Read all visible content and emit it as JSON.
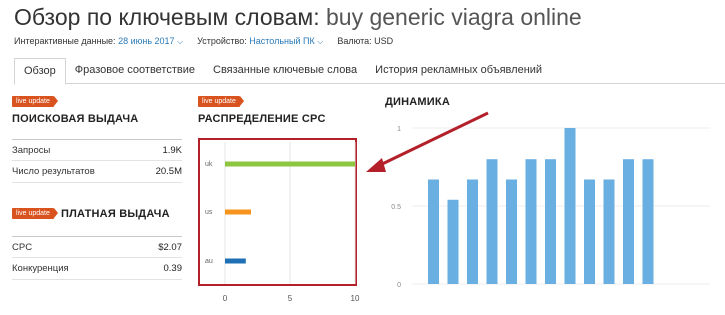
{
  "header": {
    "title_prefix": "Обзор по ключевым словам:",
    "keyword": "buy generic viagra online"
  },
  "meta": {
    "data_label": "Интерактивные данные:",
    "data_value": "28 июнь 2017",
    "device_label": "Устройство:",
    "device_value": "Настольный ПК",
    "currency": "Валюта: USD"
  },
  "tabs": [
    {
      "label": "Обзор",
      "active": true
    },
    {
      "label": "Фразовое соответствие",
      "active": false
    },
    {
      "label": "Связанные ключевые слова",
      "active": false
    },
    {
      "label": "История рекламных объявлений",
      "active": false
    }
  ],
  "badge": "live update",
  "organic": {
    "title": "ПОИСКОВАЯ ВЫДАЧА",
    "rows": [
      {
        "label": "Запросы",
        "value": "1.9K"
      },
      {
        "label": "Число результатов",
        "value": "20.5M"
      }
    ]
  },
  "paid": {
    "title": "ПЛАТНАЯ ВЫДАЧА",
    "rows": [
      {
        "label": "CPC",
        "value": "$2.07"
      },
      {
        "label": "Конкуренция",
        "value": "0.39"
      }
    ]
  },
  "cpc_dist": {
    "title": "РАСПРЕДЕЛЕНИЕ CPC",
    "colors": {
      "uk": "#8dc63f",
      "us": "#f7941d",
      "au": "#1f6fb4"
    }
  },
  "trend": {
    "title": "ДИНАМИКА",
    "bar_color": "#6aafe1"
  },
  "chart_data": [
    {
      "type": "bar",
      "orientation": "horizontal",
      "title": "РАСПРЕДЕЛЕНИЕ CPC",
      "categories": [
        "uk",
        "us",
        "au"
      ],
      "values": [
        10,
        2,
        1.6
      ],
      "xlim": [
        0,
        10
      ],
      "xticks": [
        "0",
        "5",
        "10"
      ],
      "grid": true
    },
    {
      "type": "bar",
      "title": "ДИНАМИКА",
      "values": [
        0.67,
        0.54,
        0.67,
        0.8,
        0.67,
        0.8,
        0.8,
        1.0,
        0.67,
        0.67,
        0.8,
        0.8
      ],
      "ylim": [
        0,
        1
      ],
      "yticks": [
        "0",
        "0.5",
        "1"
      ],
      "grid": true
    }
  ]
}
